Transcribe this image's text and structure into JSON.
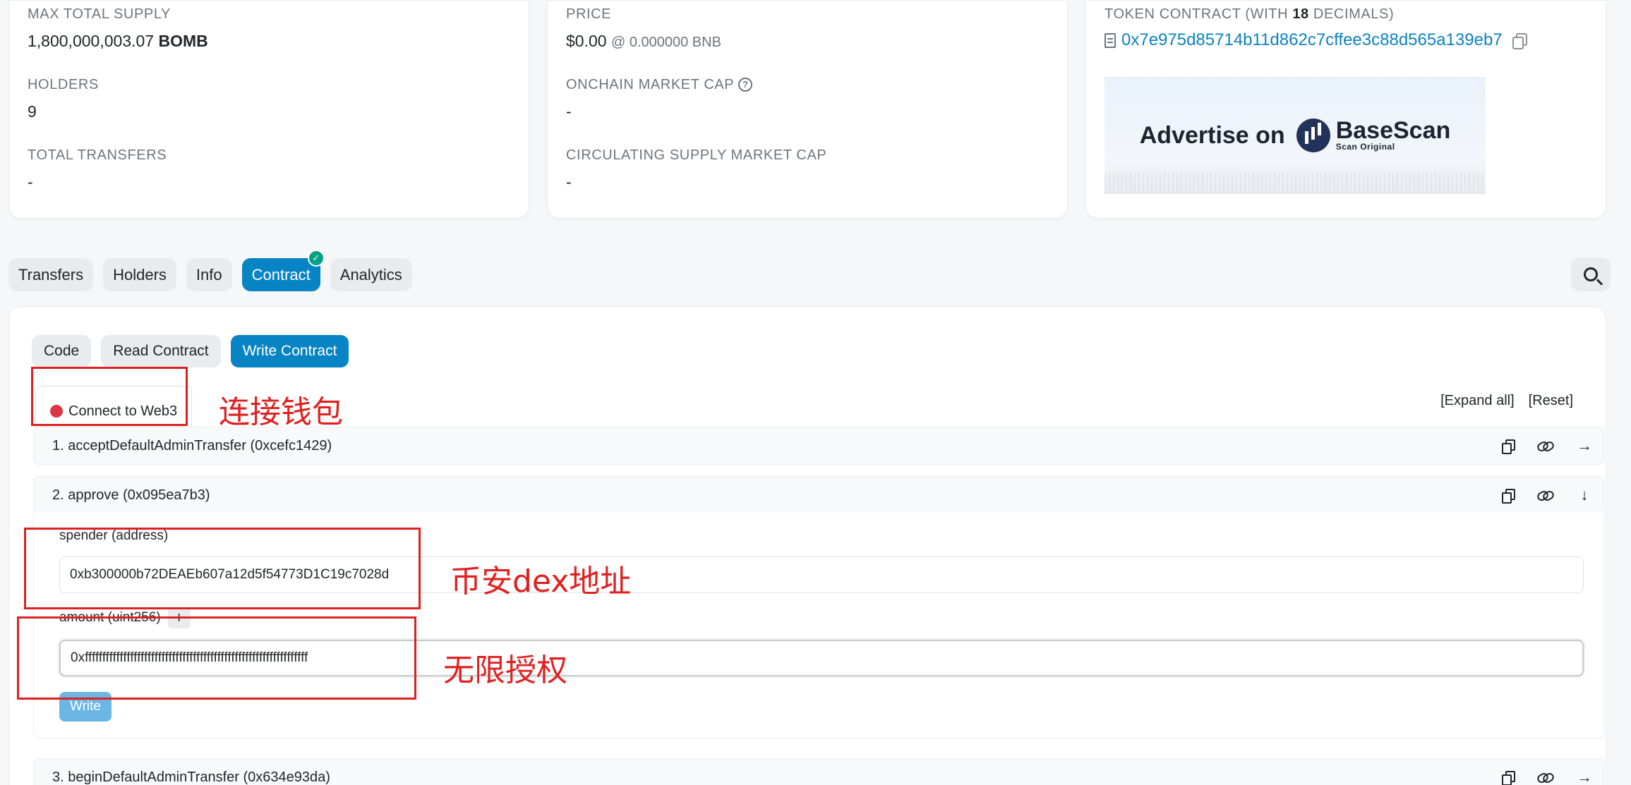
{
  "overview": {
    "max_total_supply_label": "MAX TOTAL SUPPLY",
    "max_total_supply_value": "1,800,000,003.07",
    "token_symbol": "BOMB",
    "holders_label": "HOLDERS",
    "holders_value": "9",
    "total_transfers_label": "TOTAL TRANSFERS",
    "total_transfers_value": "-",
    "price_label": "PRICE",
    "price_value": "$0.00",
    "price_native": "@ 0.000000 BNB",
    "onchain_market_cap_label": "ONCHAIN MARKET CAP",
    "onchain_market_cap_value": "-",
    "circ_market_cap_label": "CIRCULATING SUPPLY MARKET CAP",
    "circ_market_cap_value": "-",
    "token_contract_label_prefix": "TOKEN CONTRACT (WITH ",
    "token_contract_decimals": "18",
    "token_contract_label_suffix": " DECIMALS)",
    "token_contract_address": "0x7e975d85714b11d862c7cffee3c88d565a139eb7",
    "ad_text": "Advertise on",
    "ad_brand": "BaseScan",
    "ad_tagline": "Scan Original"
  },
  "tabs": {
    "transfers": "Transfers",
    "holders": "Holders",
    "info": "Info",
    "contract": "Contract",
    "analytics": "Analytics",
    "active": "contract"
  },
  "contract": {
    "subtabs": {
      "code": "Code",
      "read": "Read Contract",
      "write": "Write Contract"
    },
    "connect_label": "Connect to Web3",
    "expand_all": "[Expand all]",
    "reset": "[Reset]",
    "functions": [
      {
        "label": "1. acceptDefaultAdminTransfer (0xcefc1429)",
        "expanded": false
      },
      {
        "label": "2. approve (0x095ea7b3)",
        "expanded": true
      },
      {
        "label": "3. beginDefaultAdminTransfer (0x634e93da)",
        "expanded": false
      }
    ],
    "approve": {
      "spender_label": "spender (address)",
      "spender_value": "0xb300000b72DEAEb607a12d5f54773D1C19c7028d",
      "amount_label": "amount (uint256)",
      "amount_value": "0xffffffffffffffffffffffffffffffffffffffffffffffffffffffffffffffff",
      "write_label": "Write"
    }
  },
  "annotations": {
    "connect_wallet": "连接钱包",
    "dex_address": "币安dex地址",
    "unlimited_approval": "无限授权",
    "color": "#e02020"
  },
  "colors": {
    "primary": "#0784c3",
    "link": "#0a82c4",
    "disconnected_dot": "#dc3545",
    "verified_badge": "#00a186"
  }
}
